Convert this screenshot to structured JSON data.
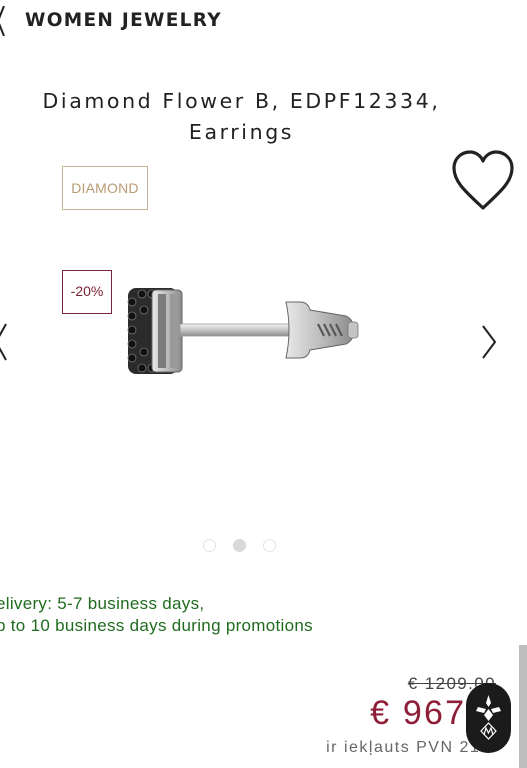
{
  "header": {
    "brand": "WOMEN JEWELRY"
  },
  "product": {
    "title_line1": "Diamond Flower B, EDPF12334,",
    "title_line2": "Earrings",
    "badge_material": "DIAMOND",
    "badge_discount": "-20%"
  },
  "carousel": {
    "total": 3,
    "active": 2
  },
  "delivery": {
    "label": "elivery: ",
    "value": "5-7 business days,",
    "line2": "p to 10 business days during promotions"
  },
  "pricing": {
    "old": "€ 1209.00",
    "new": "€ 967.2",
    "vat": "ir iekļauts PVN 21%"
  },
  "colors": {
    "sale": "#8e1d36",
    "diamond_badge": "#b79b73",
    "delivery": "#1f6b1f"
  }
}
